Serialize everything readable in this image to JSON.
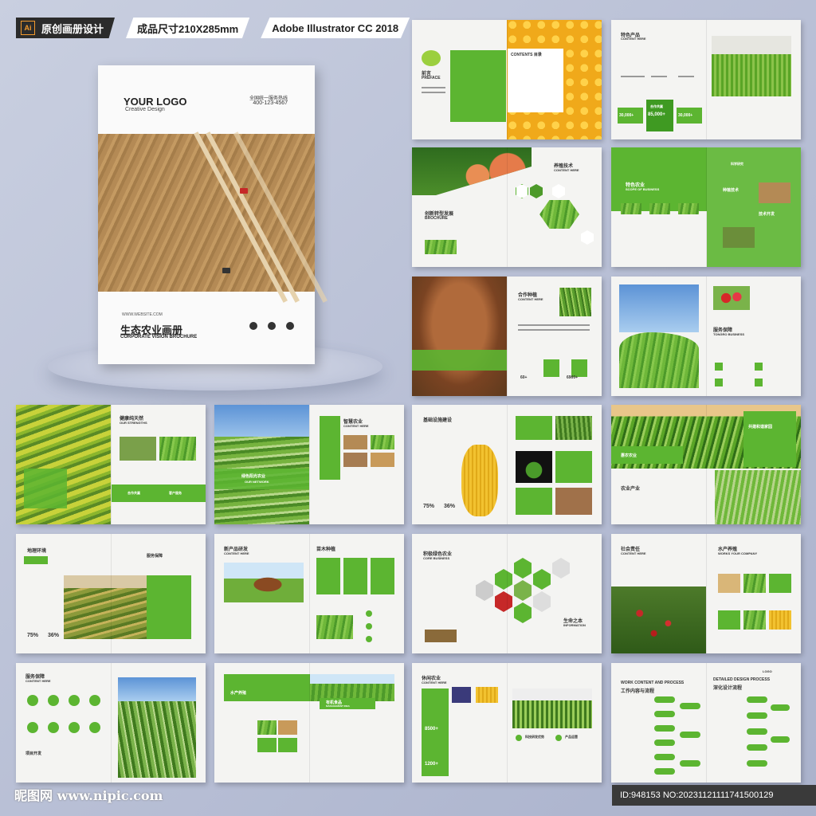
{
  "topbar": {
    "tag1": "原创画册设计",
    "tag1_icon": "Ai",
    "tag2": "成品尺寸210X285mm",
    "tag3": "Adobe Illustrator CC 2018"
  },
  "cover": {
    "logo": "YOUR LOGO",
    "logo_sub": "Creative Design",
    "hotline_label": "全国统一服务热线",
    "phone": "400-123-4567",
    "website": "WWW.WEBSITE.COM",
    "title": "生态农业画册",
    "subtitle": "CORPORATE VISION BROCHURE",
    "icons": [
      "phone-icon",
      "mail-icon",
      "location-icon"
    ]
  },
  "spreads": {
    "s1": {
      "preface": "前言",
      "preface_en": "PREFACE",
      "contents": "CONTENTS 目录"
    },
    "s2": {
      "title": "特色产品",
      "title_en": "CONTENT HERE",
      "stat1": "30,000+",
      "stat2": "85,000+",
      "stat3": "30,000+",
      "center": "合作共赢"
    },
    "s3": {
      "title": "创新转型发展",
      "title_en": "BROCHURE",
      "right": "养殖技术",
      "right_en": "CONTENT HERE"
    },
    "s4": {
      "title": "特色农业",
      "title_en": "SCOPE OF BUSINESS",
      "tech": "种植技术",
      "r1": "科学研究",
      "r2": "技术开发"
    },
    "s5": {
      "title": "合作种植",
      "title_en": "CONTENT HERE",
      "n1": "60+",
      "n2": "6900+"
    },
    "s6": {
      "title": "服务保障",
      "title_en": "TONGRO BUSINESS"
    },
    "s7": {
      "title": "健康纯天然",
      "title_en": "OUR STRENGTHS",
      "b1": "合作共赢",
      "b2": "客户服务"
    },
    "s8": {
      "title": "智慧农业",
      "title_en": "CONTENT HERE",
      "banner": "绿色阳光农业",
      "banner_en": "OUR NETWORK"
    },
    "s9": {
      "title": "基础设施建设",
      "p1": "75%",
      "p2": "36%"
    },
    "s10": {
      "title": "共建和谐家园",
      "t1": "惠农农业",
      "t2": "农业产业"
    },
    "s11": {
      "title": "地理环境",
      "p1": "75%",
      "p2": "36%",
      "right": "服务保障"
    },
    "s12": {
      "title": "新产品研发",
      "title_en": "CONTENT HERE",
      "right": "苗木种植"
    },
    "s13": {
      "title": "积极绿色农业",
      "title_en": "CORE BUSINESS",
      "right": "生命之本",
      "right_en": "INFORMATION"
    },
    "s14": {
      "title": "社会责任",
      "title_en": "CONTENT HERE",
      "right": "水产养殖",
      "right_en": "WORKS YOUR COMPANY"
    },
    "s15": {
      "title": "服务保障",
      "title_en": "CONTENT HERE",
      "bottom": "项目开发"
    },
    "s16": {
      "title": "水产养殖",
      "right": "有机食品",
      "right_en": "MANAGEMENT IDEA"
    },
    "s17": {
      "title": "休闲农业",
      "title_en": "CONTENT HERE",
      "n1": "8500+",
      "n2": "1200+",
      "r1": "科技研发优势",
      "r2": "产品运营"
    },
    "s18": {
      "title": "WORK CONTENT AND PROCESS",
      "title_cn": "工作内容与流程",
      "right": "DETAILED DESIGN PROCESS",
      "right_cn": "深化设计流程",
      "logo": "LOGO"
    }
  },
  "footer": {
    "site": "昵图网 www.nipic.com",
    "id": "ID:948153 NO:20231121111741500129"
  }
}
